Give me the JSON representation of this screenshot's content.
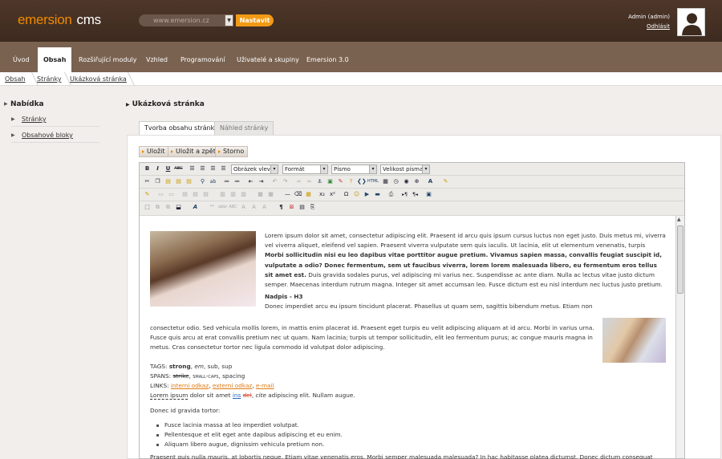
{
  "header": {
    "logo_main": "emersion",
    "logo_cms": "cms",
    "site_url": "www.emersion.cz",
    "set_button": "Nastavit",
    "user": "Admin (admin)",
    "logout": "Odhlásit",
    "colors": {
      "brand": "#f08a00",
      "header_bg": "#4a3427",
      "nav_bg": "#7a6250"
    }
  },
  "nav": {
    "items": [
      "Úvod",
      "Obsah",
      "Rozšiřující moduly",
      "Vzhled",
      "Programování",
      "Uživatelé a skupiny",
      "Emersion 3.0"
    ],
    "active": "Obsah"
  },
  "breadcrumb": [
    "Obsah",
    "Stránky",
    "Ukázková stránka"
  ],
  "sidebar": {
    "title": "Nabídka",
    "items": [
      "Stránky",
      "Obsahové bloky"
    ]
  },
  "page": {
    "title": "Ukázková stránka",
    "tabs": [
      "Tvorba obsahu stránky",
      "Náhled stránky"
    ],
    "active_tab": "Tvorba obsahu stránky",
    "actions": [
      "Uložit",
      "Uložit a zpět",
      "Storno"
    ]
  },
  "toolbar": {
    "image_align": "Obrázek vlevo",
    "format": "Formát",
    "font": "Písmo",
    "font_size": "Velikost písma"
  },
  "content": {
    "p1_a": "Lorem ipsum dolor sit amet, consectetur adipiscing elit. Praesent id arcu quis ipsum cursus luctus non eget justo. Duis metus mi, viverra vel viverra aliquet, eleifend vel sapien. Praesent viverra vulputate sem quis iaculis. Ut lacinia, elit ut elementum venenatis, turpis",
    "p1_b": "Morbi sollicitudin nisi eu leo dapibus vitae porttitor augue pretium. Vivamus sapien massa, convallis feugiat suscipit id, vulputate a odio? Donec fermentum, sem ut faucibus viverra, lorem lorem malesuada libero, eu fermentum eros tellus sit amet est.",
    "p1_c": "Duis gravida sodales purus, vel adipiscing mi varius nec. Suspendisse ac ante diam. Nulla ac lectus vitae justo dictum semper. Maecenas interdum rutrum magna. Integer sit amet accumsan leo. Fusce dictum est eu nisl interdum nec luctus justo pretium.",
    "h3": "Nadpis - H3",
    "p2_a": "Donec imperdiet arcu eu ipsum tincidunt placerat. Phasellus ut quam sem, sagittis bibendum metus. Etiam non",
    "p2_b": "consectetur odio. Sed vehicula mollis lorem, in mattis enim placerat id. Praesent eget turpis eu velit adipiscing aliquam at id arcu. Morbi in varius urna. Fusce quis arcu at erat convallis pretium nec ut quam. Nam lacinia; turpis ut tempor sollicitudin, elit leo fermentum purus; ac congue mauris magna in metus. Cras consectetur tortor nec ligula commodo id volutpat dolor adipiscing.",
    "tags_label": "TAGS:",
    "tags": [
      "strong",
      "em",
      "sub",
      "sup"
    ],
    "spans_label": "SPANS:",
    "spans": [
      "strike",
      "small-caps",
      "spacing"
    ],
    "links_label": "LINKS:",
    "links": [
      "interní odkaz",
      "externí odkaz",
      "e-mail"
    ],
    "line_a": "Lorem ipsum",
    "line_b": "dolor sit amet",
    "line_ins": "ins",
    "line_del": "del",
    "line_cite": "cite",
    "line_c": "adipiscing elit. Nullam augue.",
    "p3": "Donec id gravida tortor:",
    "list": [
      "Fusce lacinia massa at leo imperdiet volutpat.",
      "Pellentesque et elit eget ante dapibus adipiscing et eu enim.",
      "Aliquam libero augue, dignissim vehicula pretium non."
    ],
    "p4": "Praesent quis nulla mauris, at lobortis neque. Etiam vitae venenatis eros. Morbi semper malesuada malesuada? In hac habitasse platea dictumst. Donec dictum consequat sem vitae fermentum."
  }
}
